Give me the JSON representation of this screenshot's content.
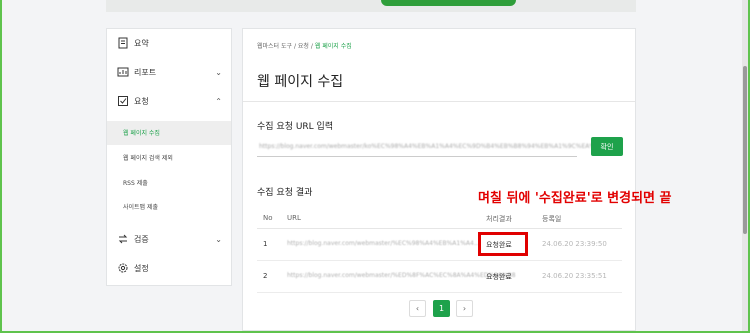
{
  "sidebar": {
    "items": [
      {
        "label": "요약",
        "icon": "summary-icon"
      },
      {
        "label": "리포트",
        "icon": "report-icon"
      },
      {
        "label": "요청",
        "icon": "request-icon"
      },
      {
        "label": "검증",
        "icon": "verify-icon"
      },
      {
        "label": "설정",
        "icon": "settings-icon"
      }
    ],
    "subitems": [
      "웹 페이지 수집",
      "웹 페이지 검색 제외",
      "RSS 제출",
      "사이트맵 제출"
    ]
  },
  "breadcrumb": {
    "a": "웹마스터 도구",
    "sep": "/",
    "b": "요청",
    "c": "웹 페이지 수집"
  },
  "page_title": "웹 페이지 수집",
  "url_section": {
    "title": "수집 요청 URL 입력",
    "value": "https://blog.naver.com/webmaster/ko%EC%98%A4%EB%A1%A4%EC%9D%B4%EB%B8%94%EB%A1%9C%EA%B7%B8",
    "button": "확인"
  },
  "results": {
    "title": "수집 요청 결과",
    "headers": {
      "no": "No",
      "url": "URL",
      "status": "처리결과",
      "date": "등록일"
    },
    "rows": [
      {
        "no": "1",
        "url": "https://blog.naver.com/webmaster/%EC%98%A4%EB%A1%A4...",
        "status": "요청완료",
        "date": "24.06.20 23:39:50"
      },
      {
        "no": "2",
        "url": "https://blog.naver.com/webmaster/%ED%8F%AC%EC%8A%A4%ED%8A%B8",
        "status": "요청완료",
        "date": "24.06.20 23:35:51"
      }
    ]
  },
  "annotation": "며칠 뒤에 '수집완료'로 변경되면 끝",
  "pagination": {
    "prev": "‹",
    "current": "1",
    "next": "›"
  },
  "colors": {
    "accent": "#1ea24b",
    "annotation": "#e20000"
  }
}
